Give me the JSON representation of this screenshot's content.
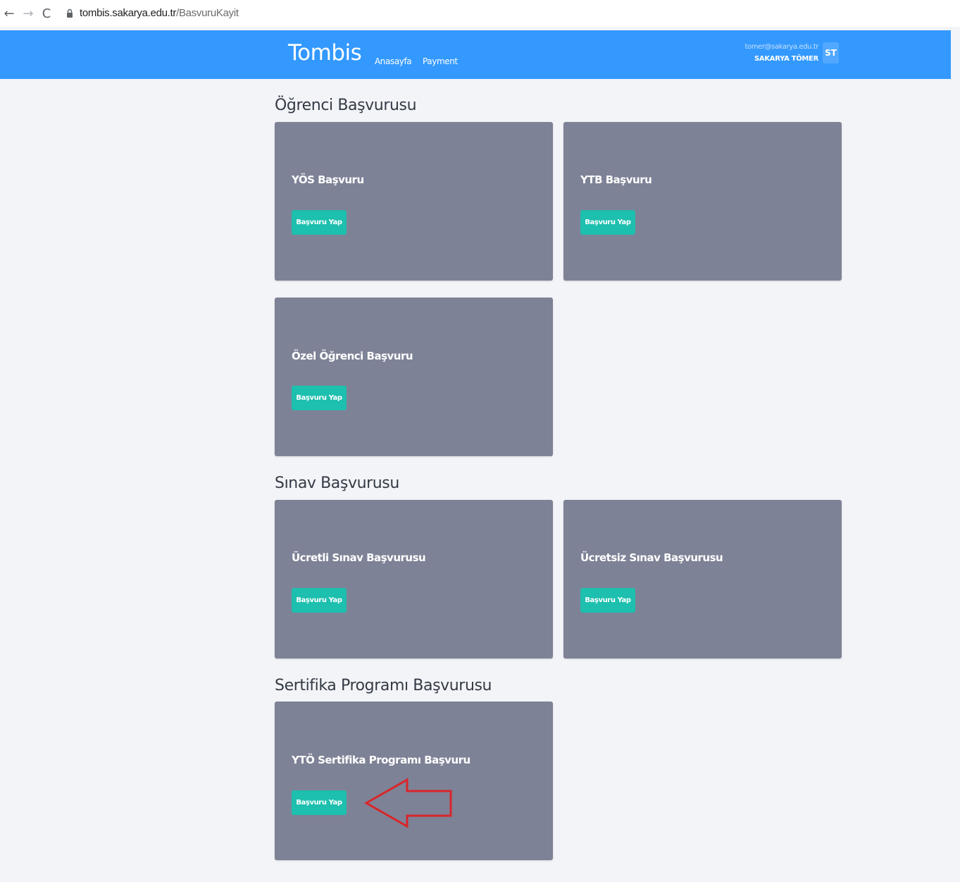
{
  "browser": {
    "url_host": "tombis.sakarya.edu.tr",
    "url_path": "/BasvuruKayit"
  },
  "header": {
    "brand": "Tombis",
    "nav": [
      "Anasayfa",
      "Payment"
    ],
    "user_email": "tomer@sakarya.edu.tr",
    "user_name": "SAKARYA TÖMER",
    "avatar_initials": "ST",
    "color": "#3399ff"
  },
  "sections": [
    {
      "title": "Öğrenci Başvurusu",
      "cards": [
        {
          "title": "YÖS Başvuru",
          "button": "Başvuru Yap"
        },
        {
          "title": "YTB Başvuru",
          "button": "Başvuru Yap"
        },
        {
          "title": "Özel Öğrenci Başvuru",
          "button": "Başvuru Yap"
        }
      ]
    },
    {
      "title": "Sınav Başvurusu",
      "cards": [
        {
          "title": "Ücretli Sınav Başvurusu",
          "button": "Başvuru Yap"
        },
        {
          "title": "Ücretsiz Sınav Başvurusu",
          "button": "Başvuru Yap"
        }
      ]
    },
    {
      "title": "Sertifika Programı Başvurusu",
      "cards": [
        {
          "title": "YTÖ Sertifika Programı Başvuru",
          "button": "Başvuru Yap"
        }
      ]
    }
  ],
  "colors": {
    "card_bg": "#7e8296",
    "button_bg": "#1dbfae",
    "annotation_arrow": "#d9262b"
  }
}
